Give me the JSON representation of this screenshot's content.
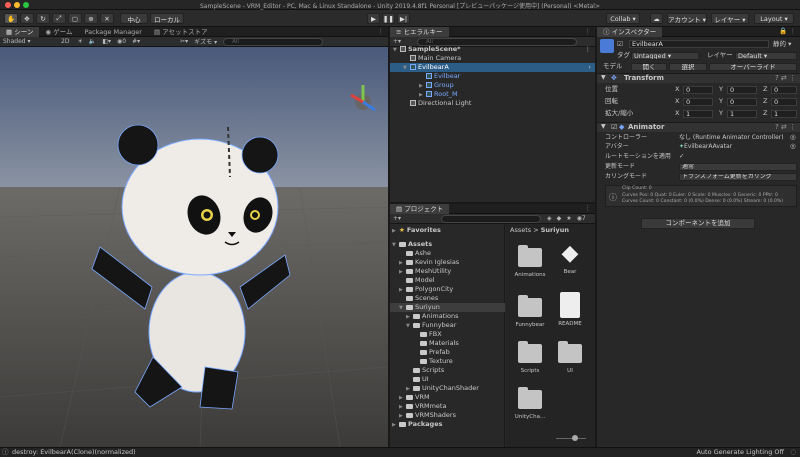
{
  "window": {
    "title": "SampleScene - VRM_Editor - PC, Mac & Linux Standalone - Unity 2019.4.8f1 Personal [プレビューパッケージ使用中] (Personal) <Metal>"
  },
  "toolbar": {
    "pivot_label": "中心",
    "space_label": "ローカル",
    "collab_label": "Collab ▾",
    "account_label": "アカウント ▾",
    "layers_label": "レイヤー ▾",
    "layout_label": "Layout ▾"
  },
  "scene": {
    "tabs": [
      "シーン",
      "ゲーム",
      "Package Manager",
      "アセットストア"
    ],
    "shading": "Shaded",
    "mode2d": "2D",
    "gizmos": "ギズモ ▾",
    "search_placeholder": "All"
  },
  "hierarchy": {
    "tab": "ヒエラルキー",
    "search_placeholder": "All",
    "items": [
      {
        "label": "SampleScene*",
        "level": 0
      },
      {
        "label": "Main Camera",
        "level": 1
      },
      {
        "label": "EvilbearA",
        "level": 1
      },
      {
        "label": "Evilbear",
        "level": 2
      },
      {
        "label": "Group",
        "level": 2
      },
      {
        "label": "Root_M",
        "level": 2
      },
      {
        "label": "Directional Light",
        "level": 1
      }
    ]
  },
  "project": {
    "tab": "プロジェクト",
    "favorites": "Favorites",
    "tree": [
      {
        "label": "Assets",
        "level": 0
      },
      {
        "label": "Ashe",
        "level": 1
      },
      {
        "label": "Kevin Iglesias",
        "level": 1
      },
      {
        "label": "MeshUtility",
        "level": 1
      },
      {
        "label": "Model",
        "level": 1
      },
      {
        "label": "PolygonCity",
        "level": 1
      },
      {
        "label": "Scenes",
        "level": 1
      },
      {
        "label": "Suriyun",
        "level": 1
      },
      {
        "label": "Animations",
        "level": 2
      },
      {
        "label": "Funnybear",
        "level": 2
      },
      {
        "label": "FBX",
        "level": 3
      },
      {
        "label": "Materials",
        "level": 3
      },
      {
        "label": "Prefab",
        "level": 3
      },
      {
        "label": "Texture",
        "level": 3
      },
      {
        "label": "Scripts",
        "level": 2
      },
      {
        "label": "UI",
        "level": 2
      },
      {
        "label": "UnityChanShader",
        "level": 2
      },
      {
        "label": "VRM",
        "level": 1
      },
      {
        "label": "VRMmeta",
        "level": 1
      },
      {
        "label": "VRMShaders",
        "level": 1
      },
      {
        "label": "Packages",
        "level": 0
      }
    ],
    "breadcrumb": [
      "Assets",
      "Suriyun"
    ],
    "assets": [
      "Animations",
      "Bear",
      "Funnybear",
      "README",
      "Scripts",
      "UI",
      "UnityCha..."
    ]
  },
  "inspector": {
    "tab": "インスペクター",
    "object_name": "EvilbearA",
    "static_label": "静的 ▾",
    "tag_label": "タグ",
    "tag_value": "Untagged",
    "layer_label": "レイヤー",
    "layer_value": "Default",
    "model_label": "モデル",
    "open_label": "開く",
    "select_label": "選択",
    "overrides_label": "オーバーライド",
    "transform": {
      "title": "Transform",
      "rows": [
        {
          "label": "位置",
          "x": "0",
          "y": "0",
          "z": "0"
        },
        {
          "label": "回転",
          "x": "0",
          "y": "0",
          "z": "0"
        },
        {
          "label": "拡大/縮小",
          "x": "1",
          "y": "1",
          "z": "1"
        }
      ]
    },
    "animator": {
      "title": "Animator",
      "controller_label": "コントローラー",
      "controller_value": "なし (Runtime Animator Controller)",
      "avatar_label": "アバター",
      "avatar_value": "EvilbearAAvatar",
      "root_motion_label": "ルートモーションを適用",
      "update_label": "更新モード",
      "update_value": "通常",
      "culling_label": "カリングモード",
      "culling_value": "トランスフォーム更新をカリング",
      "info_line1": "Clip Count: 0",
      "info_line2": "Curves Pos: 0 Quat: 0 Euler: 0 Scale: 0 Muscles: 0 Generic: 0 PPtr: 0",
      "info_line3": "Curves Count: 0 Constant: 0 (0.0%) Dense: 0 (0.0%) Stream: 0 (0.0%)"
    },
    "add_component": "コンポーネントを追加"
  },
  "status": {
    "message": "destroy: EvilbearA(Clone)(normalized)",
    "right": "Auto Generate Lighting Off"
  }
}
